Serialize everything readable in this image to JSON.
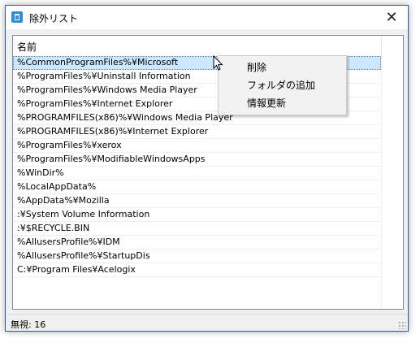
{
  "window": {
    "title": "除外リスト",
    "close_symbol": "✕"
  },
  "list": {
    "column_header": "名前",
    "selected_index": 0,
    "rows": [
      "%CommonProgramFiles%¥Microsoft",
      "%ProgramFiles%¥Uninstall Information",
      "%ProgramFiles%¥Windows Media Player",
      "%ProgramFiles%¥Internet Explorer",
      "%PROGRAMFILES(x86)%¥Windows Media Player",
      "%PROGRAMFILES(x86)%¥Internet Explorer",
      "%ProgramFiles%¥xerox",
      "%ProgramFiles%¥ModifiableWindowsApps",
      "%WinDir%",
      "%LocalAppData%",
      "%AppData%¥Mozilla",
      ":¥System Volume Information",
      ":¥$RECYCLE.BIN",
      "%AllusersProfile%¥IDM",
      "%AllusersProfile%¥StartupDis",
      "C:¥Program Files¥Acelogix"
    ]
  },
  "context_menu": {
    "items": [
      "削除",
      "フォルダの追加",
      "情報更新"
    ]
  },
  "status": {
    "text": "無視: 16"
  },
  "icons": {
    "app": "recycle-bin-icon",
    "close": "close-icon",
    "cursor": "mouse-cursor-icon",
    "grip": "resize-grip-icon"
  },
  "colors": {
    "selection": "#cce8ff",
    "window_border": "#2b5da0",
    "app_icon": "#2c8fd8"
  }
}
